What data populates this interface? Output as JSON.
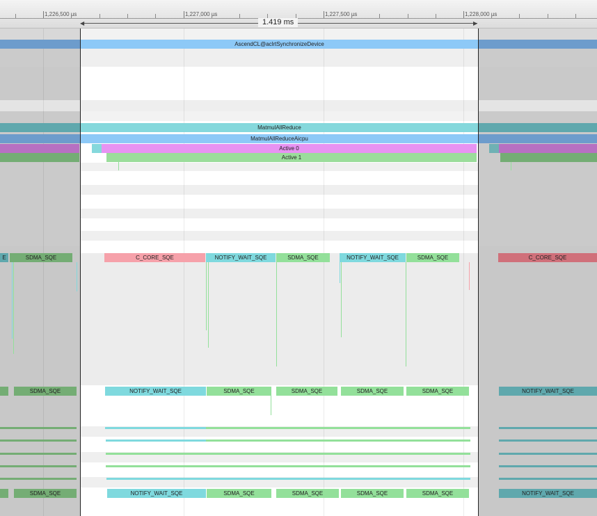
{
  "ruler": {
    "ticks": [
      "1,226,500 µs",
      "1,227,000 µs",
      "1,227,500 µs",
      "1,228,000 µs"
    ],
    "selection_span": "1.419 ms"
  },
  "colors": {
    "blue": "#8dc9f7",
    "teal": "#85d8dc",
    "magenta": "#e793f2",
    "green": "#9bdd9b",
    "cyan": "#7fd9de",
    "pink": "#f6a1aa",
    "sdma": "#93e09a"
  },
  "tracks": {
    "api_slice": "AscendCL@aclrtSynchronizeDevice",
    "op_slice": "MatmulAllReduce",
    "aicpu_slice": "MatmulAllReduceAicpu",
    "active0_slice": "Active 0",
    "active1_slice": "Active 1",
    "row1": [
      "SDMA_SQE",
      "C_CORE_SQE",
      "NOTIFY_WAIT_SQE",
      "SDMA_SQE",
      "NOTIFY_WAIT_SQE",
      "SDMA_SQE",
      "C_CORE_SQE"
    ],
    "row2": [
      "SDMA_SQE",
      "NOTIFY_WAIT_SQE",
      "SDMA_SQE",
      "SDMA_SQE",
      "SDMA_SQE",
      "SDMA_SQE",
      "NOTIFY_WAIT_SQE"
    ],
    "row3": [
      "SDMA_SQE",
      "NOTIFY_WAIT_SQE",
      "SDMA_SQE",
      "SDMA_SQE",
      "SDMA_SQE",
      "SDMA_SQE",
      "NOTIFY_WAIT_SQE"
    ]
  }
}
